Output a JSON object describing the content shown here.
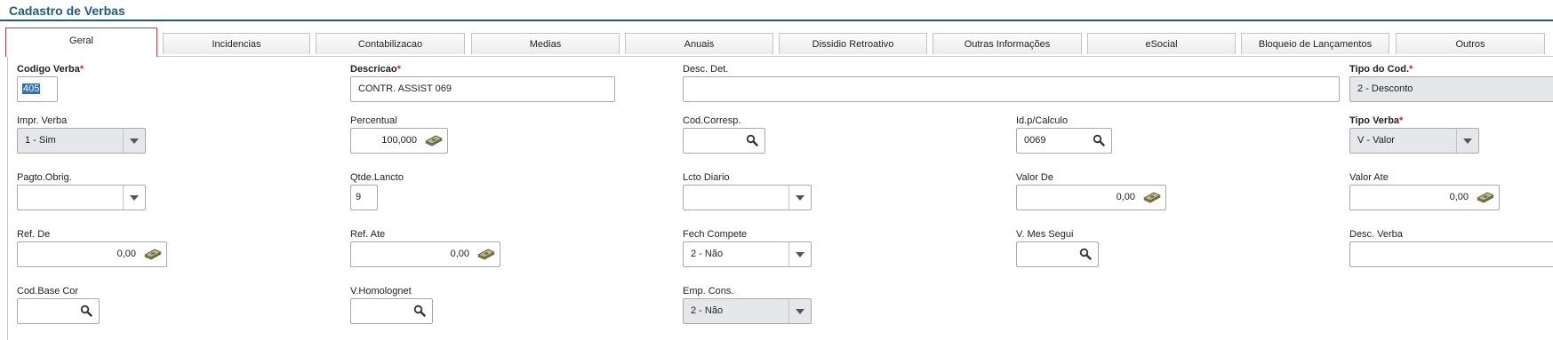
{
  "title": "Cadastro de Verbas",
  "tabs": [
    "Geral",
    "Incidencias",
    "Contabilizacao",
    "Medias",
    "Anuais",
    "Dissidio Retroativo",
    "Outras Informações",
    "eSocial",
    "Bloqueio de Lançamentos",
    "Outros"
  ],
  "fields": {
    "codigo_verba": {
      "label": "Codigo Verba",
      "req": "*",
      "value": "405"
    },
    "descricao": {
      "label": "Descricao",
      "req": "*",
      "value": "CONTR. ASSIST 069"
    },
    "desc_det": {
      "label": "Desc. Det.",
      "value": ""
    },
    "tipo_cod": {
      "label": "Tipo do Cod.",
      "req": "*",
      "value": "2 - Desconto"
    },
    "impr_verba": {
      "label": "Impr. Verba",
      "value": "1 - Sim"
    },
    "percentual": {
      "label": "Percentual",
      "value": "100,000"
    },
    "cod_corresp": {
      "label": "Cod.Corresp.",
      "value": ""
    },
    "id_calculo": {
      "label": "Id.p/Calculo",
      "value": "0069"
    },
    "tipo_verba": {
      "label": "Tipo Verba",
      "req": "*",
      "value": "V - Valor"
    },
    "pagto_obrig": {
      "label": "Pagto.Obrig.",
      "value": ""
    },
    "qtde_lancto": {
      "label": "Qtde.Lancto",
      "value": "9"
    },
    "lcto_diario": {
      "label": "Lcto Diario",
      "value": ""
    },
    "valor_de": {
      "label": "Valor De",
      "value": "0,00"
    },
    "valor_ate": {
      "label": "Valor Ate",
      "value": "0,00"
    },
    "ref_de": {
      "label": "Ref. De",
      "value": "0,00"
    },
    "ref_ate": {
      "label": "Ref. Ate",
      "value": "0,00"
    },
    "fech_compete": {
      "label": "Fech Compete",
      "value": "2 - Não"
    },
    "v_mes_segui": {
      "label": "V. Mes Segui",
      "value": ""
    },
    "desc_verba": {
      "label": "Desc. Verba",
      "value": ""
    },
    "cod_base_cor": {
      "label": "Cod.Base Cor",
      "value": ""
    },
    "v_homolognet": {
      "label": "V.Homolognet",
      "value": ""
    },
    "emp_cons": {
      "label": "Emp. Cons.",
      "value": "2 - Não"
    }
  }
}
